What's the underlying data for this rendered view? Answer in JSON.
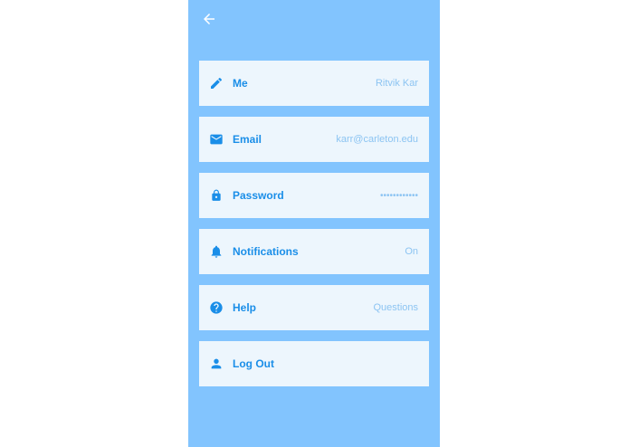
{
  "header": {
    "back_icon": "arrow-left-icon"
  },
  "colors": {
    "background": "#82c4fe",
    "row_background": "#edf6fd",
    "accent": "#1a8ee8",
    "value_text": "#8cc4f2",
    "back_arrow": "#ffffff"
  },
  "settings": [
    {
      "icon": "pencil-icon",
      "label": "Me",
      "value": "Ritvik Kar"
    },
    {
      "icon": "envelope-icon",
      "label": "Email",
      "value": "karr@carleton.edu"
    },
    {
      "icon": "lock-icon",
      "label": "Password",
      "value": "••••••••••••"
    },
    {
      "icon": "bell-icon",
      "label": "Notifications",
      "value": "On"
    },
    {
      "icon": "question-circle-icon",
      "label": "Help",
      "value": "Questions"
    },
    {
      "icon": "person-icon",
      "label": "Log Out",
      "value": ""
    }
  ]
}
